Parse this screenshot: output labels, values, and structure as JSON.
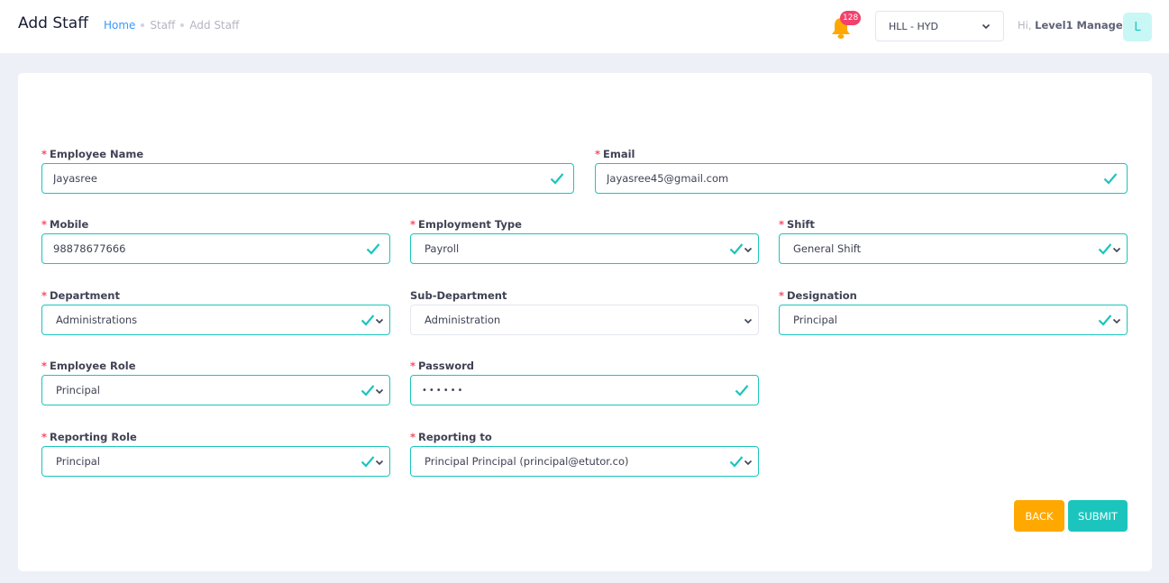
{
  "header": {
    "title": "Add Staff",
    "breadcrumb": [
      "Home",
      "Staff",
      "Add Staff"
    ],
    "notification_count": "128",
    "branch_selected": "HLL - HYD",
    "greeting_prefix": "Hi,",
    "user_name": "Level1 Manager",
    "avatar_initial": "L"
  },
  "form": {
    "employee_name": {
      "label": "Employee Name",
      "value": "Jayasree"
    },
    "email": {
      "label": "Email",
      "value": "Jayasree45@gmail.com"
    },
    "mobile": {
      "label": "Mobile",
      "value": "98878677666"
    },
    "employment_type": {
      "label": "Employment Type",
      "value": "Payroll"
    },
    "shift": {
      "label": "Shift",
      "value": "General Shift"
    },
    "department": {
      "label": "Department",
      "value": "Administrations"
    },
    "sub_department": {
      "label": "Sub-Department",
      "value": "Administration"
    },
    "designation": {
      "label": "Designation",
      "value": "Principal"
    },
    "employee_role": {
      "label": "Employee Role",
      "value": "Principal"
    },
    "password": {
      "label": "Password",
      "value": "••••••"
    },
    "reporting_role": {
      "label": "Reporting Role",
      "value": "Principal"
    },
    "reporting_to": {
      "label": "Reporting to",
      "value": "Principal Principal (principal@etutor.co)"
    }
  },
  "buttons": {
    "back": "BACK",
    "submit": "SUBMIT"
  },
  "colors": {
    "accent": "#1bc5bd",
    "warning": "#ffa800",
    "danger": "#f64e60",
    "primary": "#3699ff"
  }
}
